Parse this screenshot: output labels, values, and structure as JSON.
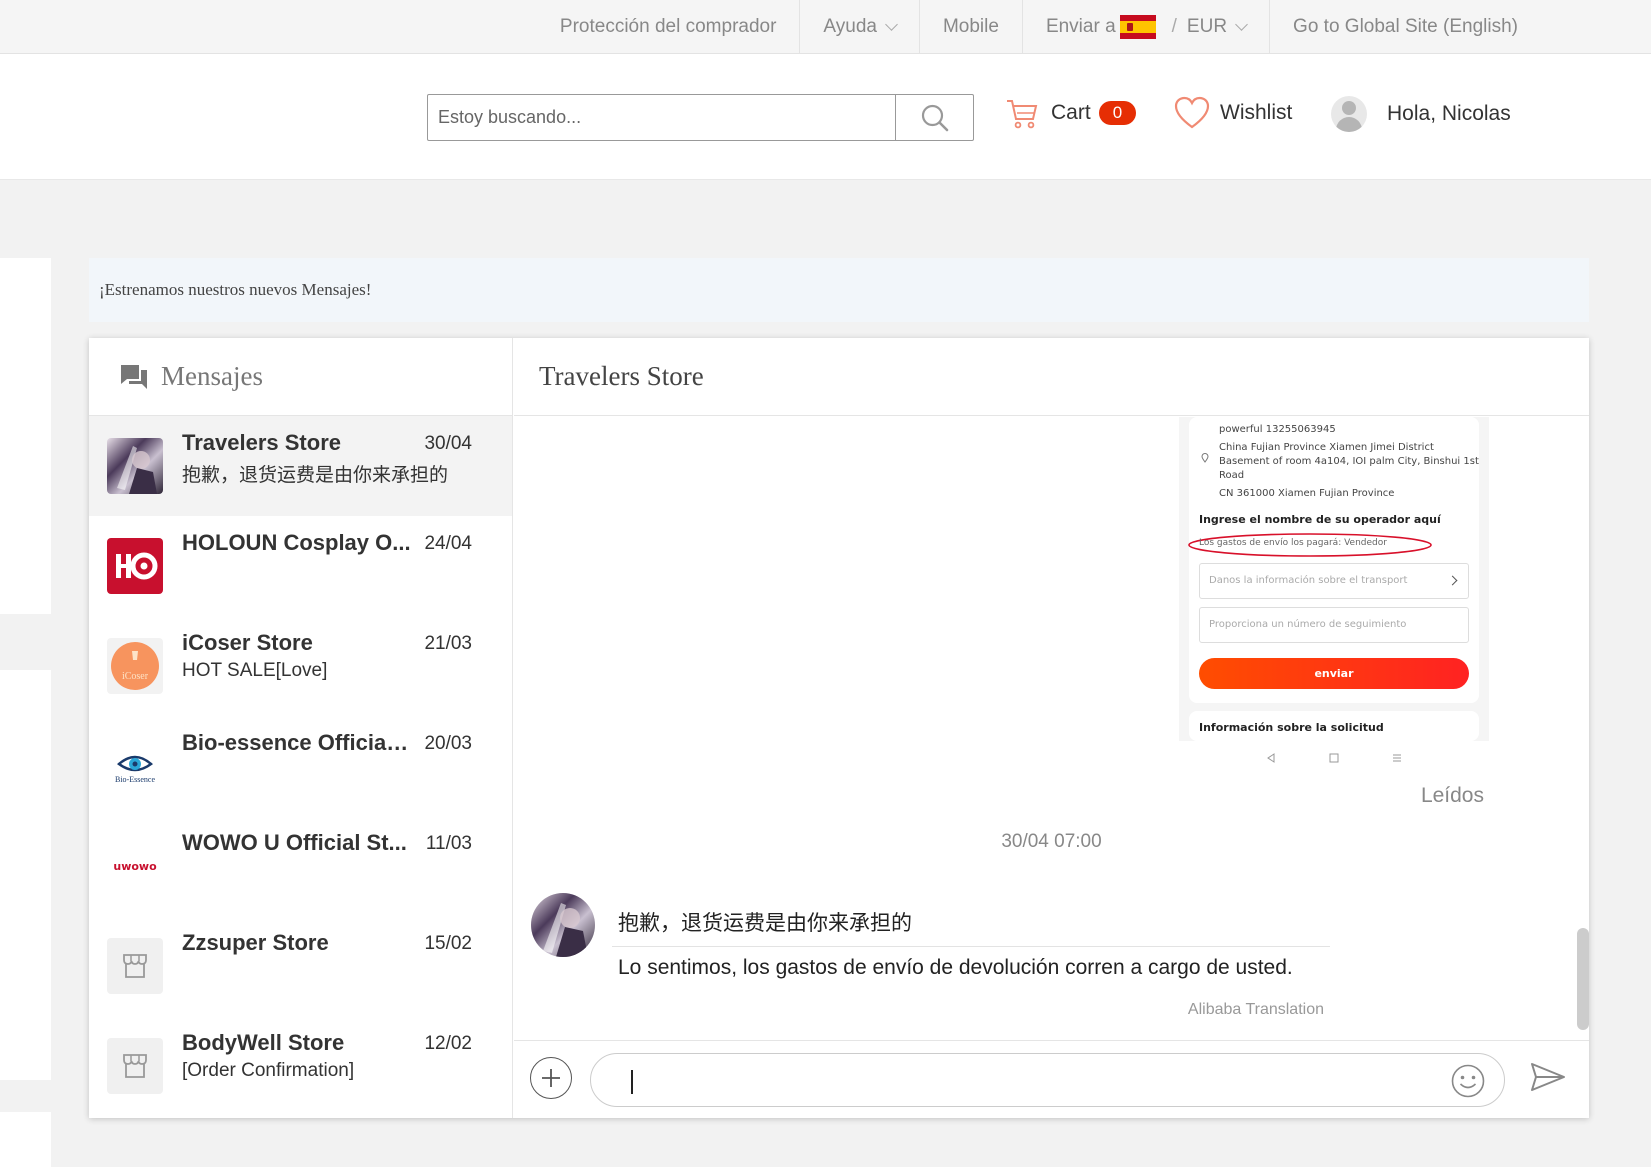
{
  "topbar": {
    "buyer_protection": "Protección del comprador",
    "help": "Ayuda",
    "mobile": "Mobile",
    "ship_to": "Enviar a",
    "currency_sep": "/",
    "currency": "EUR",
    "global_site": "Go to Global Site (English)"
  },
  "header": {
    "search_placeholder": "Estoy buscando...",
    "cart_label": "Cart",
    "cart_count": "0",
    "wishlist_label": "Wishlist",
    "greeting": "Hola, Nicolas"
  },
  "notice": "¡Estrenamos nuestros nuevos Mensajes!",
  "sidebar": {
    "title": "Mensajes",
    "conversations": [
      {
        "name": "Travelers Store",
        "date": "30/04",
        "preview": "抱歉，退货运费是由你来承担的"
      },
      {
        "name": "HOLOUN Cosplay O...",
        "date": "24/04",
        "preview": ""
      },
      {
        "name": "iCoser Store",
        "date": "21/03",
        "preview": "HOT SALE[Love]",
        "logo_text": "iCoser"
      },
      {
        "name": "Bio-essence Official ...",
        "date": "20/03",
        "preview": "",
        "logo_text": "Bio-Essence"
      },
      {
        "name": "WOWO U Official St...",
        "date": "11/03",
        "preview": "",
        "logo_text": "uwowo"
      },
      {
        "name": "Zzsuper Store",
        "date": "15/02",
        "preview": ""
      },
      {
        "name": "BodyWell Store",
        "date": "12/02",
        "preview": "[Order Confirmation]"
      }
    ]
  },
  "chat": {
    "title": "Travelers Store",
    "screenshot": {
      "phone": "powerful 13255063945",
      "address_1": "China Fujian Province Xiamen Jimei District",
      "address_2": "Basement of room 4a104, IOI palm City, Binshui 1st",
      "address_3": "Road",
      "address_4": "CN 361000 Xiamen Fujian Province",
      "carrier_label": "Ingrese el nombre de su operador aquí",
      "shipping_payer": "Los gastos de envío los pagará: Vendedor",
      "transport_placeholder": "Danos la información sobre el transport",
      "tracking_placeholder": "Proporciona un número de seguimiento",
      "submit_label": "enviar",
      "request_info": "Información sobre la solicitud"
    },
    "read_status": "Leídos",
    "timestamp": "30/04 07:00",
    "message_original": "抱歉，退货运费是由你来承担的",
    "message_translation": "Lo sentimos, los gastos de envío de devolución corren a cargo de usted.",
    "translation_source": "Alibaba Translation"
  },
  "colors": {
    "accent": "#e62e04",
    "cart_icon": "#f08a73",
    "submit_gradient_start": "#ff4d00",
    "submit_gradient_end": "#ff2222"
  }
}
